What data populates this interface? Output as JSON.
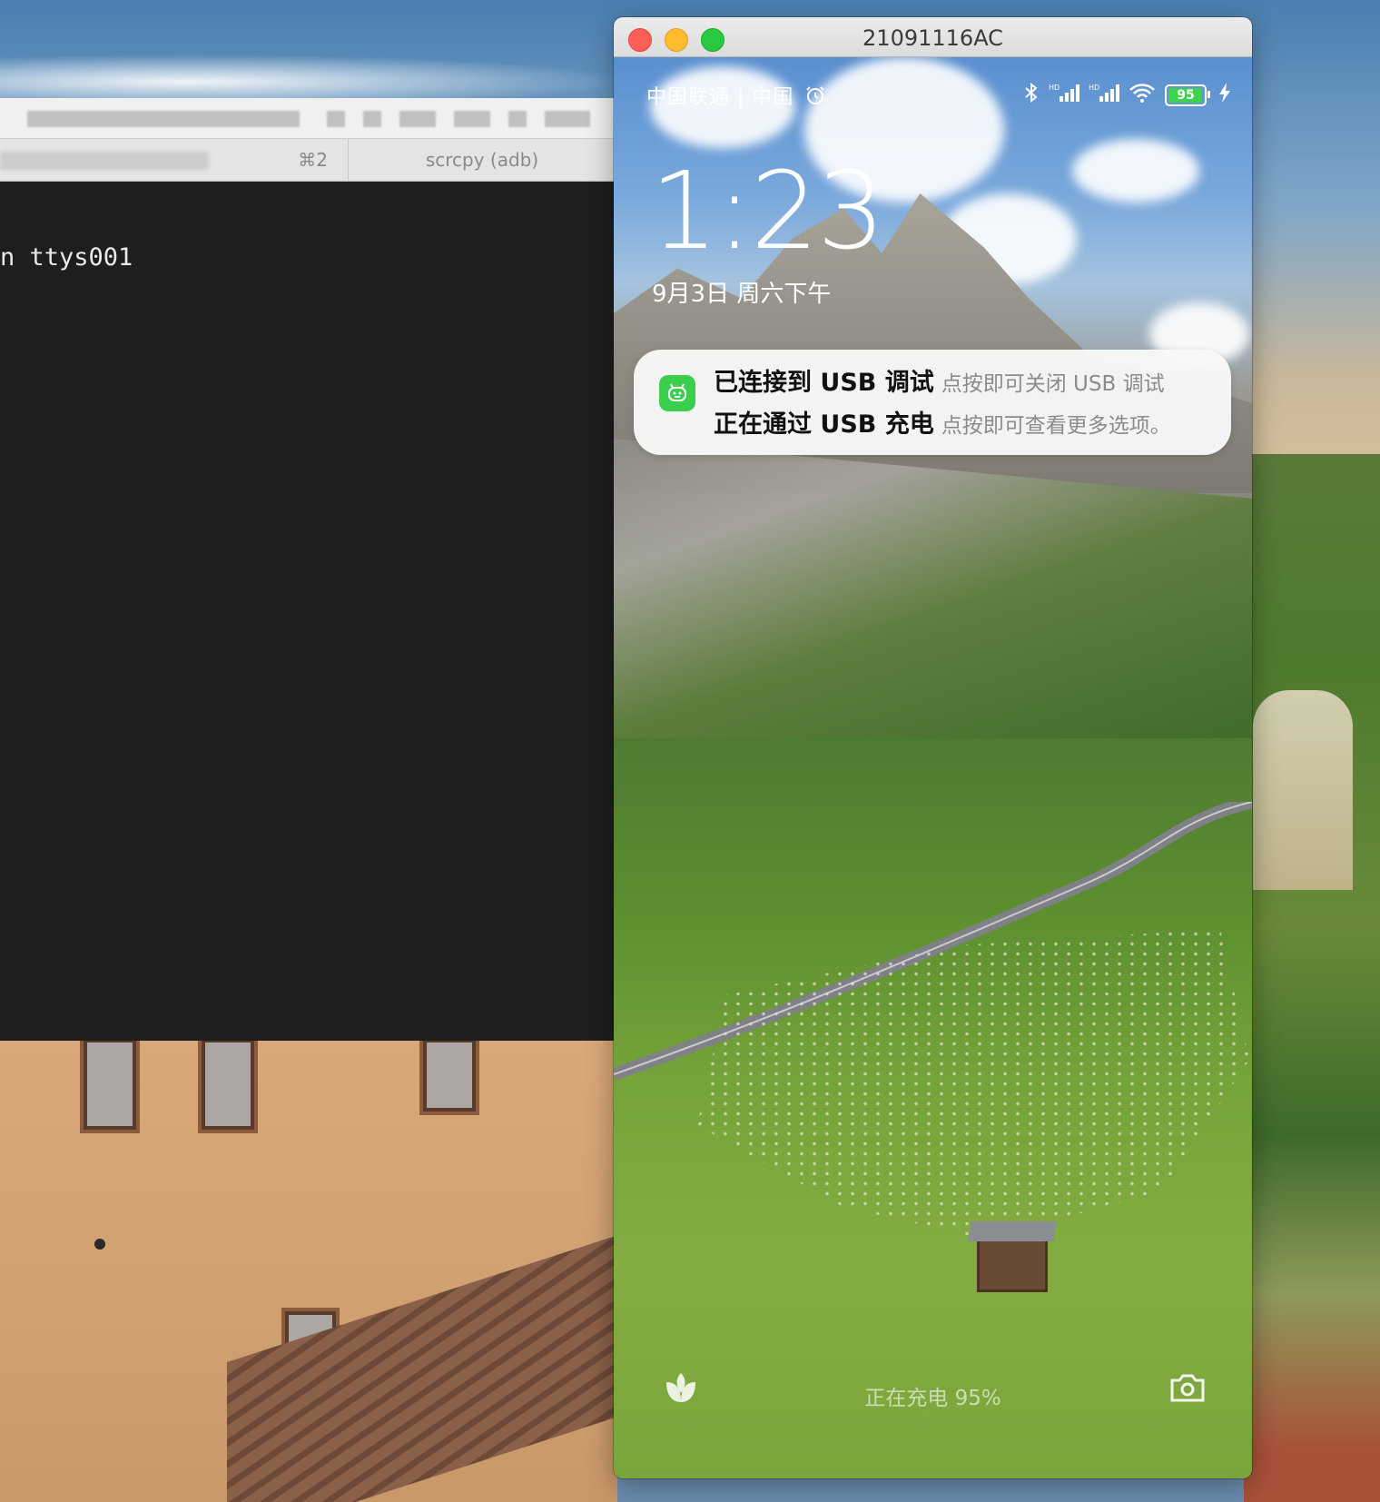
{
  "terminal": {
    "tab_shortcut": "⌘2",
    "tab_active_label": "scrcpy (adb)",
    "body_line": "n ttys001"
  },
  "scrcpy_window": {
    "title": "21091116AC"
  },
  "phone": {
    "status_bar": {
      "carrier": "中国联通 | 中国",
      "battery": "95"
    },
    "lock_screen": {
      "time": "1:23",
      "date": "9月3日 周六下午"
    },
    "notification": {
      "line1_title": "已连接到 USB 调试",
      "line1_sub": "点按即可关闭 USB 调试",
      "line2_title": "正在通过 USB 充电",
      "line2_sub": "点按即可查看更多选项。"
    },
    "charging_text": "正在充电 95%"
  },
  "icons": [
    "alarm-icon",
    "bluetooth-icon",
    "signal-hd-icon",
    "wifi-icon",
    "battery-icon",
    "charging-bolt-icon",
    "usb-debug-icon",
    "leaf-icon",
    "camera-icon"
  ],
  "colors": {
    "traffic_red": "#fe5f57",
    "traffic_yellow": "#febc2e",
    "traffic_green": "#28c840",
    "terminal_bg": "#1e1e1e",
    "battery_green": "#3bd44b",
    "notif_icon_green": "#3ccf4e"
  }
}
